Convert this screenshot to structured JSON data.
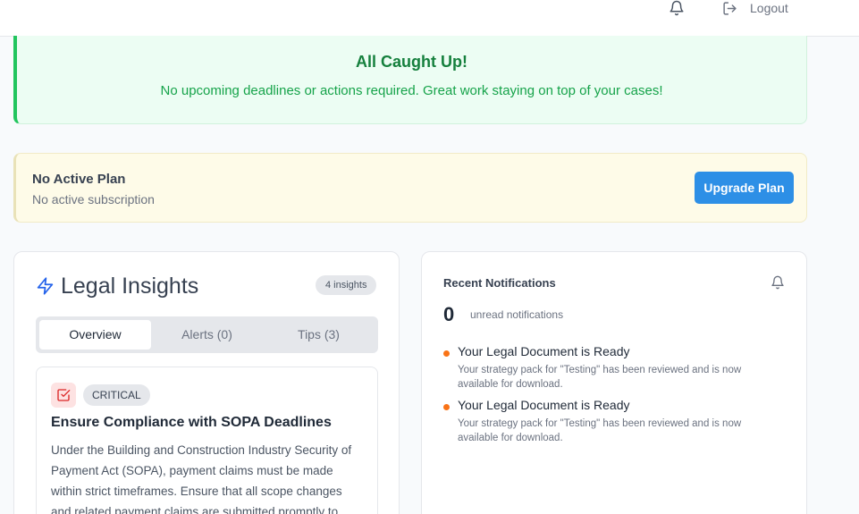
{
  "topbar": {
    "logout_label": "Logout"
  },
  "status": {
    "title": "All Caught Up!",
    "message": "No upcoming deadlines or actions required. Great work staying on top of your cases!"
  },
  "plan": {
    "title": "No Active Plan",
    "subtitle": "No active subscription",
    "button_label": "Upgrade Plan"
  },
  "insights": {
    "title": "Legal Insights",
    "count_label": "4 insights",
    "tabs": [
      {
        "label": "Overview"
      },
      {
        "label": "Alerts (0)"
      },
      {
        "label": "Tips (3)"
      }
    ],
    "card": {
      "badge": "CRITICAL",
      "title": "Ensure Compliance with SOPA Deadlines",
      "body": "Under the Building and Construction Industry Security of Payment Act (SOPA), payment claims must be made within strict timeframes. Ensure that all scope changes and related payment claims are submitted promptly to"
    }
  },
  "notifications": {
    "title": "Recent Notifications",
    "unread_count": "0",
    "unread_label": "unread notifications",
    "items": [
      {
        "title": "Your Legal Document is Ready",
        "body": "Your strategy pack for \"Testing\" has been reviewed and is now available for download."
      },
      {
        "title": "Your Legal Document is Ready",
        "body": "Your strategy pack for \"Testing\" has been reviewed and is now available for download."
      }
    ]
  },
  "colors": {
    "success": "#16a34a",
    "primary": "#2d8fe6",
    "critical": "#dc2626",
    "unread_dot": "#f97316"
  },
  "icons": [
    "bell-icon",
    "logout-icon",
    "zap-icon",
    "checkbox-icon"
  ]
}
